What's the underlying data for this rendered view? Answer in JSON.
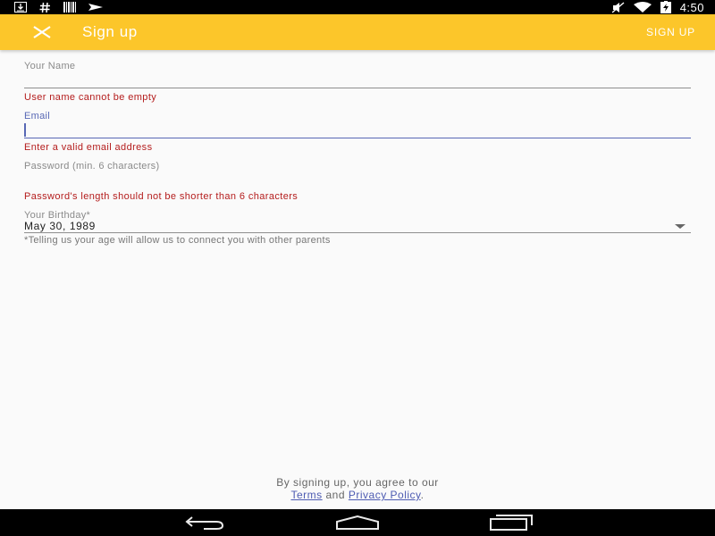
{
  "status_bar": {
    "time": "4:50",
    "left_icons": [
      "download-icon",
      "hashtag-icon",
      "barcode-icon",
      "paper-plane-icon"
    ],
    "right_icons": [
      "mute-icon",
      "wifi-icon",
      "battery-charging-icon"
    ]
  },
  "app_bar": {
    "title": "Sign up",
    "action_label": "SIGN UP",
    "close_icon": "close-icon",
    "background_color": "#fcc62a"
  },
  "form": {
    "name": {
      "label": "Your Name",
      "value": "",
      "error": "User name cannot be empty"
    },
    "email": {
      "label": "Email",
      "value": "",
      "error": "Enter a valid email address"
    },
    "password": {
      "label": "Password (min. 6 characters)",
      "value": "",
      "error": "Password's length should not be shorter than 6 characters"
    },
    "birthday": {
      "label": "Your Birthday*",
      "value": "May 30, 1989",
      "note": "*Telling us your age will allow us to connect you with other parents"
    }
  },
  "footer": {
    "line1": "By signing up, you agree to our",
    "terms_label": "Terms",
    "and_text": "and",
    "privacy_label": "Privacy Policy",
    "end_punct": "."
  },
  "nav_bar": {
    "icons": [
      "back-icon",
      "home-icon",
      "recents-icon"
    ]
  },
  "colors": {
    "accent": "#5868b5",
    "error": "#b41c1c",
    "app_bar": "#fcc62a"
  }
}
